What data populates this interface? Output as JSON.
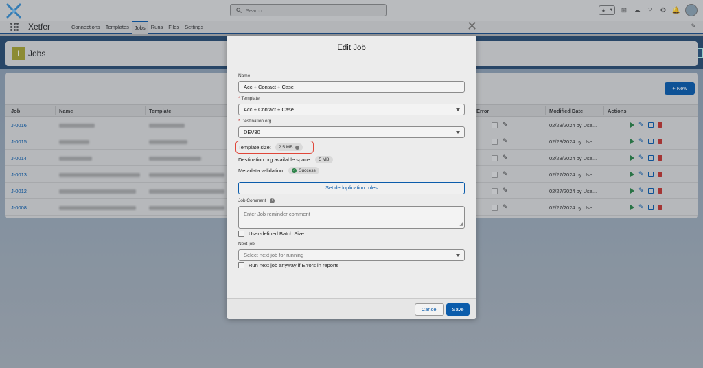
{
  "app": {
    "name": "Xetfer",
    "search_placeholder": "Search...",
    "nav_tabs": [
      "Connections",
      "Templates",
      "Jobs",
      "Runs",
      "Files",
      "Settings"
    ],
    "active_tab": "Jobs"
  },
  "page": {
    "title": "Jobs",
    "new_button": "+ New",
    "columns": {
      "job": "Job",
      "name": "Name",
      "template": "Template",
      "error": "Error",
      "modified_date": "Modified Date",
      "actions": "Actions"
    },
    "rows": [
      {
        "id": "J-0016",
        "modified": "02/28/2024 by Use..."
      },
      {
        "id": "J-0015",
        "modified": "02/28/2024 by Use..."
      },
      {
        "id": "J-0014",
        "modified": "02/28/2024 by Use..."
      },
      {
        "id": "J-0013",
        "modified": "02/27/2024 by Use..."
      },
      {
        "id": "J-0012",
        "modified": "02/27/2024 by Use..."
      },
      {
        "id": "J-0008",
        "modified": "02/27/2024 by Use..."
      }
    ]
  },
  "modal": {
    "title": "Edit Job",
    "name_label": "Name",
    "name_value": "Acc + Contact + Case",
    "template_label": "Template",
    "template_value": "Acc + Contact + Case",
    "required_mark": "*",
    "dest_label": "Destination org",
    "dest_value": "DEV30",
    "template_size_label": "Template size:",
    "template_size_value": "2.5 MB",
    "dest_space_label": "Destination org available space:",
    "dest_space_value": "5 MB",
    "metadata_label": "Metadata validation:",
    "metadata_value": "Success",
    "dedup_button": "Set deduplication rules",
    "comment_label": "Job Comment",
    "comment_placeholder": "Enter Job reminder comment",
    "batch_size_label": "User-defined Batch Size",
    "next_job_label": "Next job",
    "next_job_placeholder": "Select next job for running",
    "run_anyway_label": "Run next job anyway if Errors in reports",
    "cancel_button": "Cancel",
    "save_button": "Save"
  },
  "colors": {
    "brand_blue": "#0b5cab",
    "success_green": "#2e844a",
    "delete_red": "#c23934",
    "highlight_red": "#e0473a",
    "jobs_icon": "#a5a233"
  }
}
